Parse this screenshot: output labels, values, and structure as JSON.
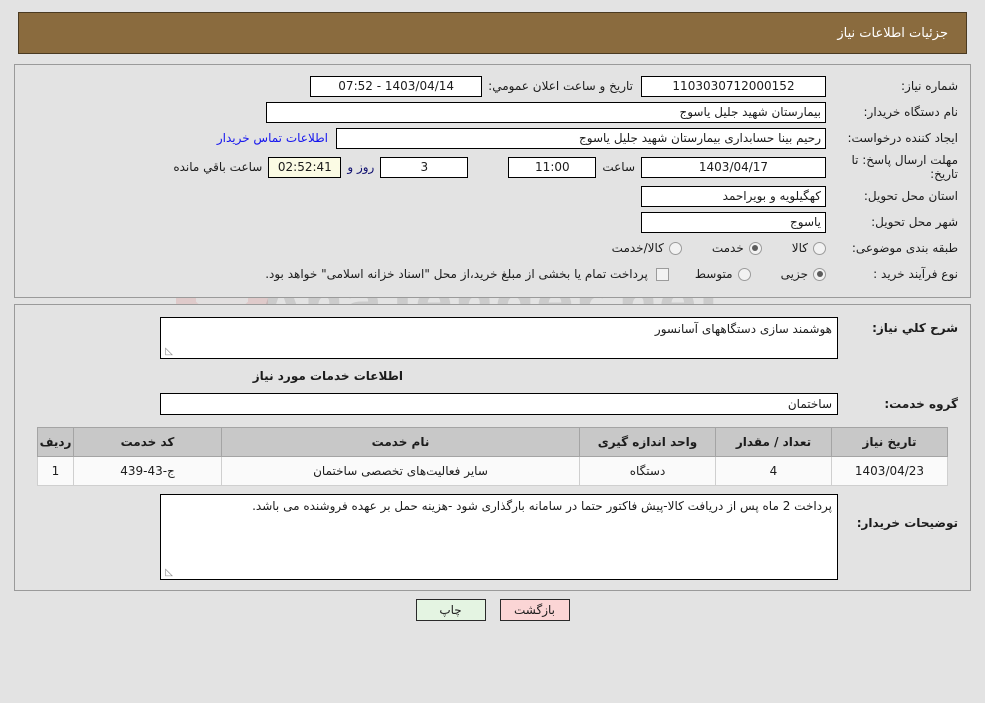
{
  "header": {
    "title": "جزئیات اطلاعات نیاز"
  },
  "watermark": {
    "text": "AnaTender.net",
    "left_mark": "L"
  },
  "top_form": {
    "need_number_label": "شماره نیاز:",
    "need_number_value": "1103030712000152",
    "public_announce_label": "تاریخ و ساعت اعلان عمومي:",
    "public_announce_value": "1403/04/14 - 07:52",
    "buyer_org_label": "نام دستگاه خریدار:",
    "buyer_org_value": "بیمارستان شهید جلیل یاسوج",
    "creator_label": "ایجاد کننده درخواست:",
    "creator_value": "رحیم بینا حسابداری بیمارستان شهید جلیل یاسوج",
    "contact_link": "اطلاعات تماس خریدار",
    "deadline_label": "مهلت ارسال پاسخ: تا تاریخ:",
    "deadline_date": "1403/04/17",
    "hour_label": "ساعت",
    "deadline_hour": "11:00",
    "days_value": "3",
    "days_text": "روز و",
    "timer_value": "02:52:41",
    "timer_text": "ساعت باقي مانده",
    "province_label": "استان محل تحویل:",
    "province_value": "کهگیلویه و بویراحمد",
    "city_label": "شهر محل تحویل:",
    "city_value": "یاسوج",
    "category_label": "طبقه بندی موضوعی:",
    "category_options": [
      {
        "label": "کالا",
        "checked": false
      },
      {
        "label": "خدمت",
        "checked": true
      },
      {
        "label": "کالا/خدمت",
        "checked": false
      }
    ],
    "process_label": "نوع فرآیند خرید :",
    "process_options": [
      {
        "label": "جزیی",
        "checked": true
      },
      {
        "label": "متوسط",
        "checked": false
      }
    ],
    "treasury_checkbox_text": "پرداخت تمام یا بخشی از مبلغ خرید،از محل \"اسناد خزانه اسلامی\" خواهد بود.",
    "treasury_checked": false
  },
  "bottom": {
    "summary_label": "شرح کلي نیاز:",
    "summary_value": "هوشمند سازی دستگاههای آسانسور",
    "services_head": "اطلاعات خدمات مورد نیاز",
    "service_group_label": "گروه خدمت:",
    "service_group_value": "ساختمان",
    "table": {
      "columns": [
        "ردیف",
        "کد خدمت",
        "نام خدمت",
        "واحد اندازه گیری",
        "تعداد / مقدار",
        "تاریخ نیاز"
      ],
      "rows": [
        {
          "index": "1",
          "code": "ج-43-439",
          "name": "سایر فعالیت‌های تخصصی ساختمان",
          "unit": "دستگاه",
          "qty": "4",
          "date": "1403/04/23"
        }
      ]
    },
    "notes_label": "توضیحات خریدار:",
    "notes_value": "پرداخت 2 ماه پس از دریافت کالا-پیش فاکتور حتما در سامانه بارگذاری شود -هزینه حمل بر عهده فروشنده می باشد.",
    "resize_grip": "◺"
  },
  "footer": {
    "print_label": "چاپ",
    "back_label": "بازگشت"
  },
  "colors": {
    "header_brown": "#8a6b3e",
    "page_bg": "#e3e3e3",
    "link_blue": "#1515ee",
    "timer_bg": "#fbfbe4",
    "print_bg": "#e4f4e2",
    "back_bg": "#fbd5d5",
    "table_header_bg": "#c8c8c8"
  }
}
